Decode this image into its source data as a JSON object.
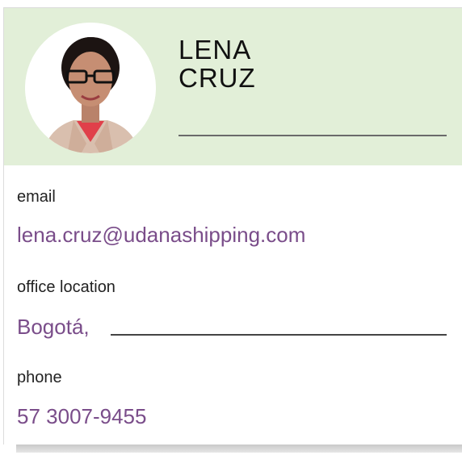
{
  "profile": {
    "name": "LENA\nCRUZ",
    "avatar": "person-photo"
  },
  "fields": {
    "email": {
      "label": "email",
      "value": "lena.cruz@udanashipping.com"
    },
    "office": {
      "label": "office location",
      "value": "Bogotá,"
    },
    "phone": {
      "label": "phone",
      "value": "57 3007-9455"
    }
  },
  "colors": {
    "header_bg": "#e2efd8",
    "value_text": "#7a4d8a"
  }
}
